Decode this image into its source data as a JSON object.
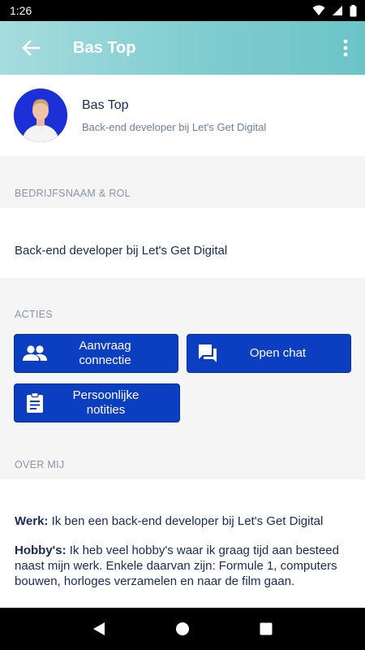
{
  "status": {
    "time": "1:26"
  },
  "header": {
    "title": "Bas Top"
  },
  "profile": {
    "name": "Bas Top",
    "subtitle": "Back-end developer bij Let's Get Digital"
  },
  "sections": {
    "company_role": {
      "label": "BEDRIJFSNAAM & ROL",
      "value": "Back-end developer bij Let's Get Digital"
    },
    "actions": {
      "label": "ACTIES",
      "request_connection": "Aanvraag\nconnectie",
      "open_chat": "Open chat",
      "personal_notes": "Persoonlijke\nnotities"
    },
    "about": {
      "label": "OVER MIJ",
      "work_label": "Werk:",
      "work_text": " Ik ben een back-end developer bij Let's Get Digital",
      "hobbies_label": "Hobby's:",
      "hobbies_text": " Ik heb veel hobby's waar ik graag tijd aan besteed naast mijn werk. Enkele daarvan zijn: Formule 1, computers bouwen, horloges verzamelen en naar de film gaan."
    }
  },
  "icons": {
    "back": "arrow-back-icon",
    "more": "more-vert-icon",
    "people": "people-icon",
    "chat": "chat-icon",
    "clipboard": "clipboard-icon"
  },
  "colors": {
    "accent": "#0c3ec2",
    "header_start": "#a6dcde",
    "header_end": "#6cc3c7",
    "text": "#1a2a55"
  }
}
